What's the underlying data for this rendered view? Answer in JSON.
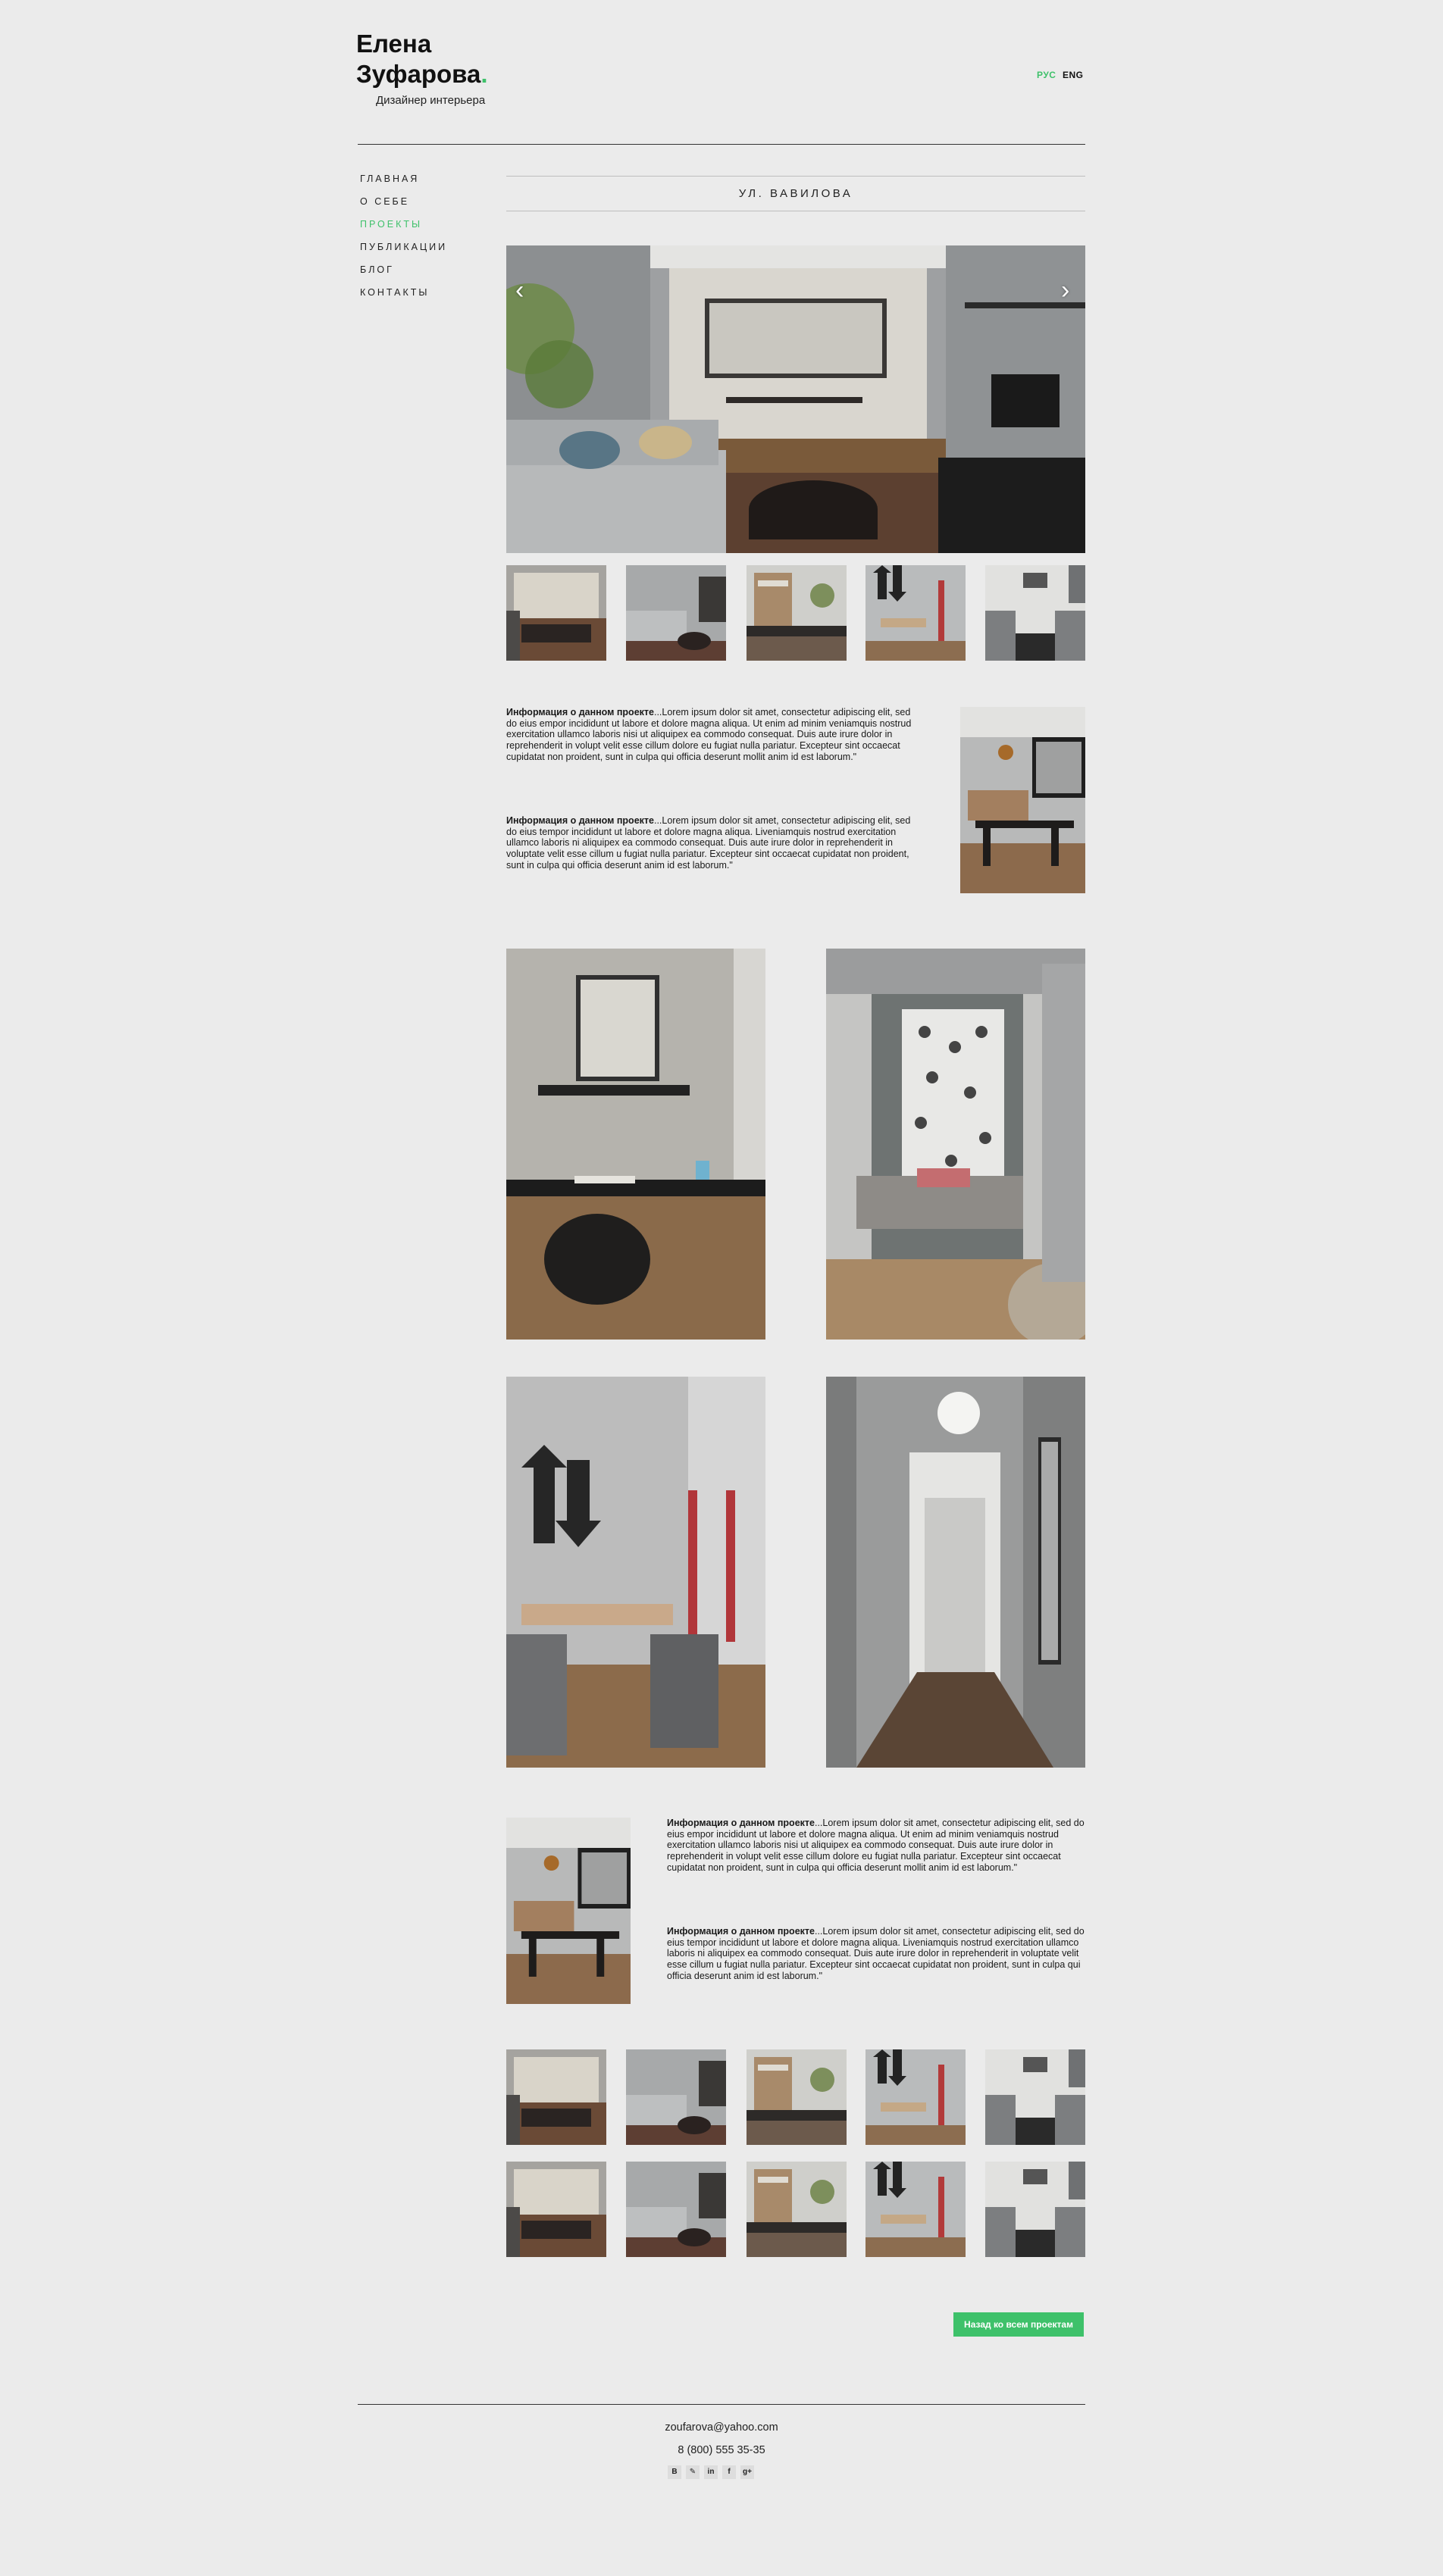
{
  "header": {
    "name_line1": "Елена",
    "name_line2": "Зуфарова",
    "name_dot": ".",
    "subtitle": "Дизайнер интерьера",
    "lang_ru": "РУС",
    "lang_en": "ENG"
  },
  "nav": {
    "items": [
      "ГЛАВНАЯ",
      "О СЕБЕ",
      "ПРОЕКТЫ",
      "ПУБЛИКАЦИИ",
      "БЛОГ",
      "КОНТАКТЫ"
    ],
    "active": "ПРОЕКТЫ"
  },
  "project": {
    "title": "УЛ. ВАВИЛОВА",
    "info_label": "Информация о данном проекте",
    "para1": "...Lorem ipsum dolor sit amet, consectetur adipiscing elit, sed do eius empor incididunt ut labore et dolore magna aliqua. Ut enim ad minim veniamquis nostrud exercitation ullamco laboris nisi ut aliquipex ea commodo consequat. Duis aute irure dolor in reprehenderit in volupt velit esse cillum dolore eu fugiat nulla pariatur. Excepteur sint occaecat cupidatat non proident, sunt in culpa qui officia deserunt mollit anim id est laborum.\"",
    "para2": "...Lorem ipsum dolor sit amet, consectetur adipiscing elit, sed do eius tempor incididunt ut labore et dolore magna aliqua. Liveniamquis nostrud exercitation ullamco laboris ni aliquipex ea commodo consequat. Duis aute irure dolor in reprehenderit in voluptate velit esse cillum u fugiat nulla pariatur. Excepteur sint occaecat cupidatat non proident, sunt in culpa qui officia deserunt anim id est laborum.\"",
    "para3": "...Lorem ipsum dolor sit amet, consectetur adipiscing elit, sed do eius empor incididunt ut labore et dolore magna aliqua. Ut enim ad minim veniamquis nostrud exercitation ullamco laboris nisi ut aliquipex ea commodo consequat. Duis aute irure dolor in reprehenderit in volupt velit esse cillum dolore eu fugiat nulla pariatur. Excepteur sint occaecat cupidatat non proident, sunt in culpa qui officia deserunt mollit anim id est laborum.\"",
    "para4": "...Lorem ipsum dolor sit amet, consectetur adipiscing elit, sed do eius tempor incididunt ut labore et dolore magna aliqua. Liveniamquis nostrud exercitation ullamco laboris ni aliquipex ea commodo consequat. Duis aute irure dolor in reprehenderit in voluptate velit esse cillum u fugiat nulla pariatur. Excepteur sint occaecat cupidatat non proident, sunt in culpa qui officia deserunt anim id est laborum.\"",
    "slider_prev": "‹",
    "slider_next": "›",
    "back_button": "Назад ко всем проектам"
  },
  "footer": {
    "email": "zoufarova@yahoo.com",
    "phone": "8 (800) 555 35-35",
    "social": [
      "B",
      "✎",
      "in",
      "f",
      "g+"
    ]
  },
  "colors": {
    "accent": "#3ec16a",
    "background": "#ebebeb",
    "text": "#111111"
  },
  "icons": [
    "prev-arrow-icon",
    "next-arrow-icon",
    "behance-icon",
    "pinterest-icon",
    "linkedin-icon",
    "facebook-icon",
    "google-plus-icon"
  ]
}
